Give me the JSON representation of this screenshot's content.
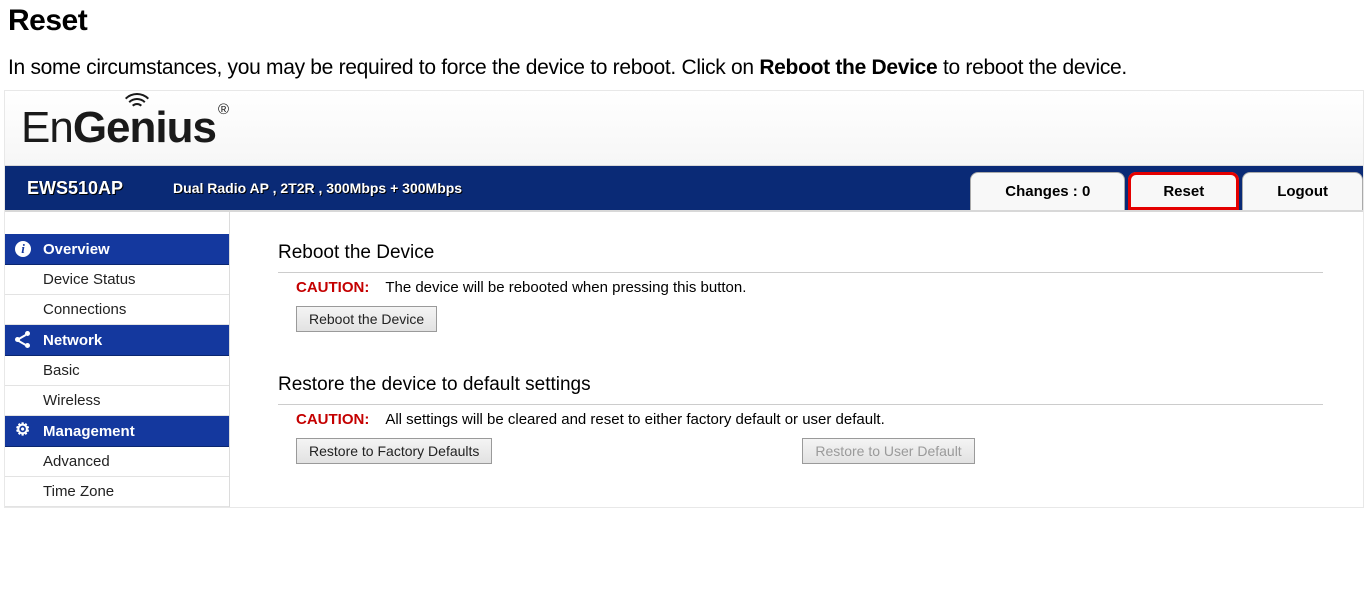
{
  "doc": {
    "heading": "Reset",
    "para_prefix": "In some circumstances, you may be required to force the device to reboot. Click on ",
    "para_bold": "Reboot the Device",
    "para_suffix": " to reboot the device."
  },
  "logo": {
    "prefix": "En",
    "suffix": "Genius",
    "registered": "®"
  },
  "topbar": {
    "model": "EWS510AP",
    "description": "Dual Radio AP , 2T2R , 300Mbps + 300Mbps",
    "changes_label": "Changes : 0",
    "reset_label": "Reset",
    "logout_label": "Logout"
  },
  "sidebar": {
    "overview_header": "Overview",
    "overview_items": [
      "Device Status",
      "Connections"
    ],
    "network_header": "Network",
    "network_items": [
      "Basic",
      "Wireless"
    ],
    "management_header": "Management",
    "management_items": [
      "Advanced",
      "Time Zone"
    ]
  },
  "main": {
    "reboot": {
      "title": "Reboot the Device",
      "caution_label": "CAUTION:",
      "caution_text": "The device will be rebooted when pressing this button.",
      "button_label": "Reboot the Device"
    },
    "restore": {
      "title": "Restore the device to default settings",
      "caution_label": "CAUTION:",
      "caution_text": "All settings will be cleared and reset to either factory default or user default.",
      "factory_button_label": "Restore to Factory Defaults",
      "user_button_label": "Restore to User Default"
    }
  }
}
